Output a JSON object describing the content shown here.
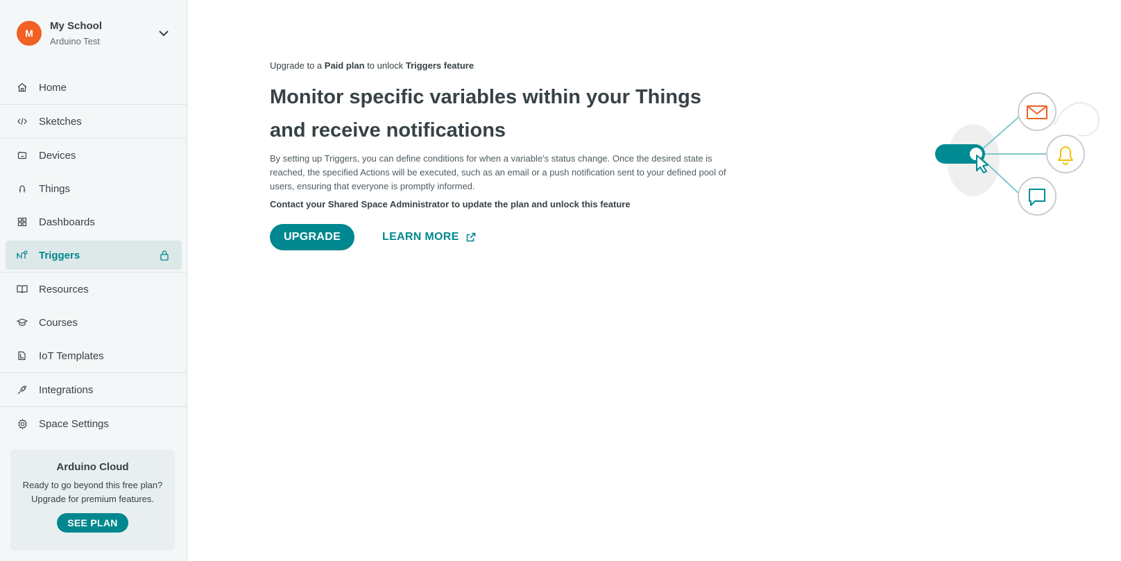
{
  "space": {
    "avatar_letter": "M",
    "name": "My School",
    "subtitle": "Arduino Test"
  },
  "nav": {
    "items": [
      {
        "label": "Home",
        "icon": "home-icon"
      },
      {
        "label": "Sketches",
        "icon": "code-icon"
      },
      {
        "label": "Devices",
        "icon": "device-icon"
      },
      {
        "label": "Things",
        "icon": "thing-icon"
      },
      {
        "label": "Dashboards",
        "icon": "dashboard-icon"
      },
      {
        "label": "Triggers",
        "icon": "trigger-icon",
        "active": true,
        "locked": true
      },
      {
        "label": "Resources",
        "icon": "book-icon"
      },
      {
        "label": "Courses",
        "icon": "graduation-cap-icon"
      },
      {
        "label": "IoT Templates",
        "icon": "templates-icon"
      },
      {
        "label": "Integrations",
        "icon": "plug-icon"
      },
      {
        "label": "Space Settings",
        "icon": "gear-icon"
      }
    ]
  },
  "promo": {
    "title": "Arduino Cloud",
    "line1": "Ready to go beyond this free plan?",
    "line2": "Upgrade for premium features.",
    "button": "SEE PLAN"
  },
  "main": {
    "eyebrow_prefix": "Upgrade to a ",
    "eyebrow_plan": "Paid plan",
    "eyebrow_middle": " to unlock ",
    "eyebrow_feature": "Triggers feature",
    "headline": "Monitor specific variables within your Things and receive notifications",
    "description": "By setting up Triggers, you can define conditions for when a variable's status change. Once the desired state is reached, the specified Actions will be executed, such as an email or a push notification sent to your defined pool of users, ensuring that everyone is promptly informed.",
    "contact": "Contact your Shared Space Administrator to update the plan and unlock this feature",
    "upgrade_button": "UPGRADE",
    "learn_more": "LEARN MORE"
  },
  "colors": {
    "accent": "#00878f",
    "avatar": "#f06123",
    "mail": "#f06123",
    "bell": "#f2c100"
  }
}
